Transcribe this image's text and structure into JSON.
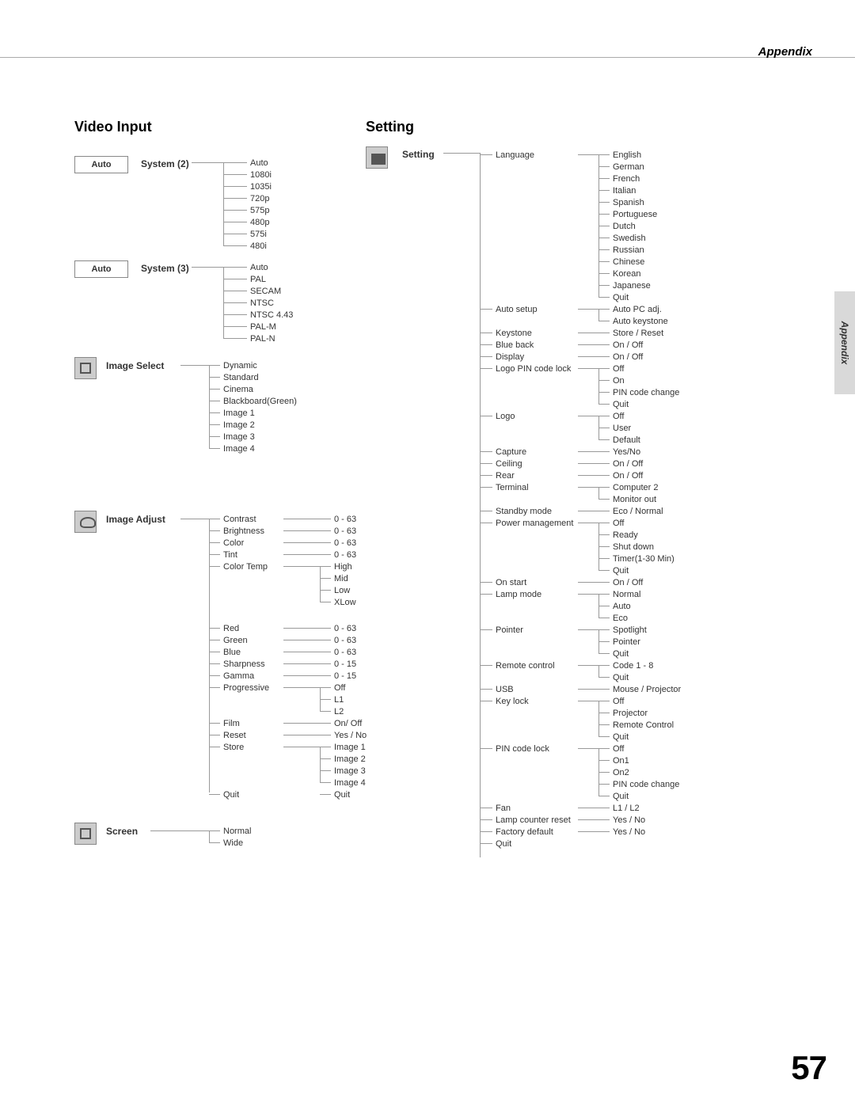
{
  "header": {
    "title": "Appendix"
  },
  "side_tab": "Appendix",
  "page_number": "57",
  "video_input": {
    "heading": "Video Input",
    "icon_auto": "Auto",
    "system2": {
      "label": "System",
      "suffix": "(2)",
      "items": [
        "Auto",
        "1080i",
        "1035i",
        "720p",
        "575p",
        "480p",
        "575i",
        "480i"
      ]
    },
    "system3": {
      "label": "System",
      "suffix": "(3)",
      "items": [
        "Auto",
        "PAL",
        "SECAM",
        "NTSC",
        "NTSC 4.43",
        "PAL-M",
        "PAL-N"
      ]
    },
    "image_select": {
      "label": "Image Select",
      "items": [
        "Dynamic",
        "Standard",
        "Cinema",
        "Blackboard(Green)",
        "Image 1",
        "Image 2",
        "Image 3",
        "Image 4"
      ]
    },
    "image_adjust": {
      "label": "Image Adjust",
      "rows": [
        {
          "name": "Contrast",
          "val": "0 - 63"
        },
        {
          "name": "Brightness",
          "val": "0 - 63"
        },
        {
          "name": "Color",
          "val": "0 - 63"
        },
        {
          "name": "Tint",
          "val": "0 - 63"
        }
      ],
      "color_temp": {
        "name": "Color Temp",
        "items": [
          "High",
          "Mid",
          "Low",
          "XLow"
        ]
      },
      "rgb": [
        {
          "name": "Red",
          "val": "0 - 63"
        },
        {
          "name": "Green",
          "val": "0 - 63"
        },
        {
          "name": "Blue",
          "val": "0 - 63"
        },
        {
          "name": "Sharpness",
          "val": "0 - 15"
        },
        {
          "name": "Gamma",
          "val": "0 - 15"
        }
      ],
      "progressive": {
        "name": "Progressive",
        "items": [
          "Off",
          "L1",
          "L2"
        ]
      },
      "film": {
        "name": "Film",
        "val": "On/ Off"
      },
      "reset": {
        "name": "Reset",
        "val": "Yes / No"
      },
      "store": {
        "name": "Store",
        "items": [
          "Image 1",
          "Image 2",
          "Image 3",
          "Image 4"
        ]
      },
      "quit": {
        "name": "Quit",
        "val": "Quit"
      }
    },
    "screen": {
      "label": "Screen",
      "items": [
        "Normal",
        "Wide"
      ]
    }
  },
  "setting": {
    "heading": "Setting",
    "root": "Setting",
    "language": {
      "name": "Language",
      "items": [
        "English",
        "German",
        "French",
        "Italian",
        "Spanish",
        "Portuguese",
        "Dutch",
        "Swedish",
        "Russian",
        "Chinese",
        "Korean",
        "Japanese",
        "Quit"
      ]
    },
    "auto_setup": {
      "name": "Auto setup",
      "items": [
        "Auto PC adj.",
        "Auto keystone"
      ]
    },
    "keystone": {
      "name": "Keystone",
      "val": "Store / Reset"
    },
    "blue_back": {
      "name": "Blue back",
      "val": "On / Off"
    },
    "display": {
      "name": "Display",
      "val": "On / Off"
    },
    "logo_pin": {
      "name": "Logo PIN code lock",
      "items": [
        "Off",
        "On",
        "PIN code change",
        "Quit"
      ]
    },
    "logo": {
      "name": "Logo",
      "items": [
        "Off",
        "User",
        "Default"
      ]
    },
    "capture": {
      "name": "Capture",
      "val": "Yes/No"
    },
    "ceiling": {
      "name": "Ceiling",
      "val": "On / Off"
    },
    "rear": {
      "name": "Rear",
      "val": "On / Off"
    },
    "terminal": {
      "name": "Terminal",
      "items": [
        "Computer 2",
        "Monitor out"
      ]
    },
    "standby": {
      "name": "Standby mode",
      "val": "Eco / Normal"
    },
    "power_mgmt": {
      "name": "Power management",
      "items": [
        "Off",
        "Ready",
        "Shut down",
        "Timer(1-30 Min)",
        "Quit"
      ]
    },
    "on_start": {
      "name": "On start",
      "val": "On / Off"
    },
    "lamp_mode": {
      "name": "Lamp mode",
      "items": [
        "Normal",
        "Auto",
        "Eco"
      ]
    },
    "pointer": {
      "name": "Pointer",
      "items": [
        "Spotlight",
        "Pointer",
        "Quit"
      ]
    },
    "remote": {
      "name": "Remote control",
      "items": [
        "Code 1 - 8",
        "Quit"
      ]
    },
    "usb": {
      "name": "USB",
      "val": "Mouse / Projector"
    },
    "key_lock": {
      "name": "Key lock",
      "items": [
        "Off",
        "Projector",
        "Remote Control",
        "Quit"
      ]
    },
    "pin_lock": {
      "name": "PIN code lock",
      "items": [
        "Off",
        "On1",
        "On2",
        "PIN code change",
        "Quit"
      ]
    },
    "fan": {
      "name": "Fan",
      "val": "L1 / L2"
    },
    "lamp_counter": {
      "name": "Lamp counter reset",
      "val": "Yes / No"
    },
    "factory": {
      "name": "Factory default",
      "val": "Yes / No"
    },
    "quit": "Quit"
  }
}
